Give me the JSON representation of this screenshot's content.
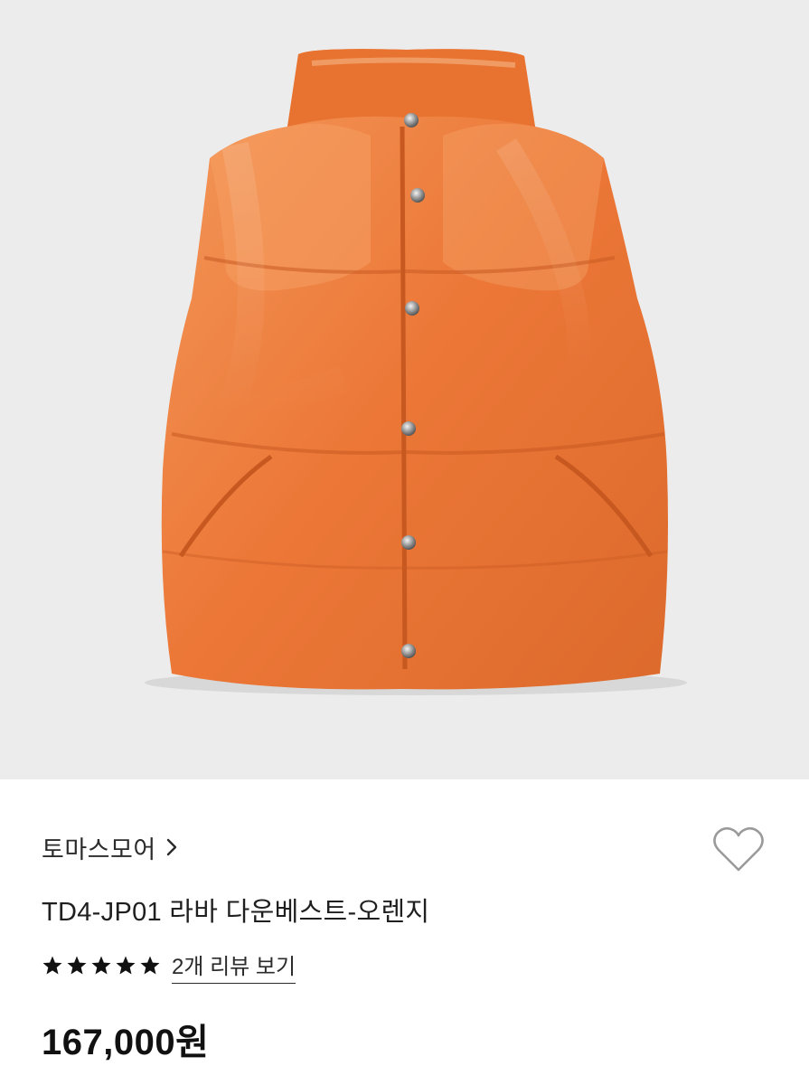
{
  "product": {
    "image_alt": "orange down vest",
    "brand": "토마스모어",
    "title": "TD4-JP01 라바 다운베스트-오렌지",
    "rating": 5,
    "rating_max": 5,
    "review_link": "2개 리뷰 보기",
    "price": "167,000원"
  },
  "icons": {
    "brand_arrow": "chevron-right-icon",
    "wishlist": "heart-outline-icon",
    "rating": "star-icon"
  },
  "colors": {
    "image_background": "#ececec",
    "vest_orange": "#ef7a3e",
    "text": "#1a1a1a",
    "heart_outline": "#9a9a9a"
  }
}
